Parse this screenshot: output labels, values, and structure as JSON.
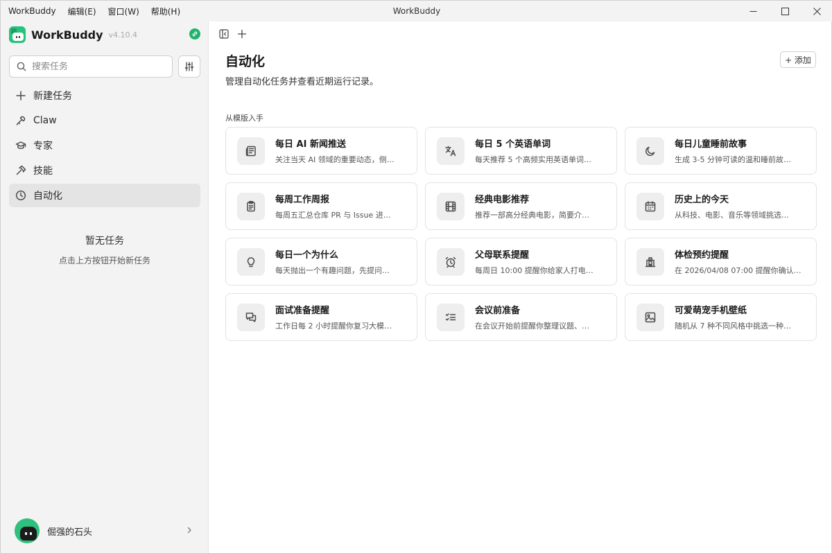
{
  "window": {
    "title": "WorkBuddy",
    "menus": [
      "WorkBuddy",
      "编辑(E)",
      "窗口(W)",
      "帮助(H)"
    ]
  },
  "sidebar": {
    "brand_name": "WorkBuddy",
    "version": "v4.10.4",
    "search_placeholder": "搜索任务",
    "nav": [
      {
        "label": "新建任务",
        "icon": "plus-icon"
      },
      {
        "label": "Claw",
        "icon": "claw-icon"
      },
      {
        "label": "专家",
        "icon": "graduation-cap-icon"
      },
      {
        "label": "技能",
        "icon": "hammer-icon"
      },
      {
        "label": "自动化",
        "icon": "clock-icon",
        "active": true
      }
    ],
    "empty_title": "暂无任务",
    "empty_subtitle": "点击上方按钮开始新任务",
    "user_name": "倔强的石头"
  },
  "main": {
    "title": "自动化",
    "subtitle": "管理自动化任务并查看近期运行记录。",
    "add_label": "+ 添加",
    "section_label": "从模版入手",
    "templates": [
      {
        "title": "每日 AI 新闻推送",
        "desc": "关注当天 AI 领域的重要动态，侧…",
        "icon": "newspaper-icon"
      },
      {
        "title": "每日 5 个英语单词",
        "desc": "每天推荐 5 个高频实用英语单词…",
        "icon": "translate-icon"
      },
      {
        "title": "每日儿童睡前故事",
        "desc": "生成 3-5 分钟可读的温和睡前故…",
        "icon": "moon-icon"
      },
      {
        "title": "每周工作周报",
        "desc": "每周五汇总仓库 PR 与 Issue 进…",
        "icon": "clipboard-icon"
      },
      {
        "title": "经典电影推荐",
        "desc": "推荐一部高分经典电影，简要介…",
        "icon": "film-icon"
      },
      {
        "title": "历史上的今天",
        "desc": "从科技、电影、音乐等领域挑选…",
        "icon": "calendar-icon"
      },
      {
        "title": "每日一个为什么",
        "desc": "每天抛出一个有趣问题，先提问…",
        "icon": "lightbulb-icon"
      },
      {
        "title": "父母联系提醒",
        "desc": "每周日 10:00 提醒你给家人打电…",
        "icon": "alarm-clock-icon"
      },
      {
        "title": "体检预约提醒",
        "desc": "在 2026/04/08 07:00 提醒你确认…",
        "icon": "hospital-icon"
      },
      {
        "title": "面试准备提醒",
        "desc": "工作日每 2 小时提醒你复习大模…",
        "icon": "chat-icon"
      },
      {
        "title": "会议前准备",
        "desc": "在会议开始前提醒你整理议题、…",
        "icon": "checklist-icon"
      },
      {
        "title": "可爱萌宠手机壁纸",
        "desc": "随机从 7 种不同风格中挑选一种…",
        "icon": "image-icon"
      }
    ]
  }
}
